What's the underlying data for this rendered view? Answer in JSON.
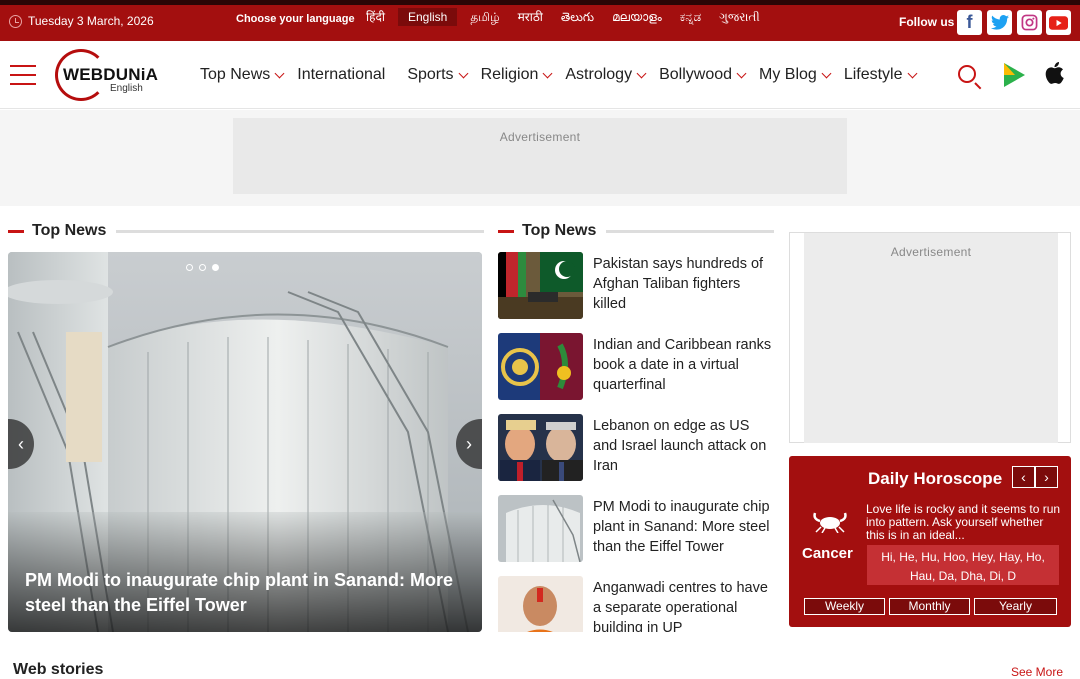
{
  "topbar": {
    "date": "Tuesday 3 March, 2026",
    "language_label": "Choose your language",
    "languages": [
      "हिंदी",
      "English",
      "தமிழ்",
      "मराठी",
      "తెలుగు",
      "മലയാളം",
      "ಕನ್ನಡ",
      "ગુજરાતી"
    ],
    "active_language": "English",
    "follow_label": "Follow us",
    "social_icons": [
      "facebook-icon",
      "twitter-icon",
      "instagram-icon",
      "youtube-icon"
    ],
    "colors": {
      "background": "#a30f0f",
      "active": "#7b0b0b"
    }
  },
  "header": {
    "logo_text": "WEBDUNiA",
    "logo_sub": "English",
    "menu": [
      {
        "label": "Top News",
        "dropdown": true
      },
      {
        "label": "International",
        "dropdown": false
      },
      {
        "label": "Sports",
        "dropdown": true
      },
      {
        "label": "Religion",
        "dropdown": true
      },
      {
        "label": "Astrology",
        "dropdown": true
      },
      {
        "label": "Bollywood",
        "dropdown": true
      },
      {
        "label": "My Blog",
        "dropdown": true
      },
      {
        "label": "Lifestyle",
        "dropdown": true
      }
    ],
    "icons": [
      "search-icon",
      "google-play-icon",
      "apple-icon"
    ]
  },
  "ads": {
    "top": "Advertisement",
    "right": "Advertisement"
  },
  "featured": {
    "heading": "Top News",
    "slide_title": "PM Modi to inaugurate chip plant in Sanand: More steel than the Eiffel Tower",
    "slide_count": 3,
    "active_slide": 3
  },
  "news_list": {
    "heading": "Top News",
    "items": [
      {
        "title": "Pakistan says hundreds of Afghan Taliban fighters killed"
      },
      {
        "title": "Indian and Caribbean ranks book a date in a virtual quarterfinal"
      },
      {
        "title": "Lebanon on edge as US and Israel launch attack on Iran"
      },
      {
        "title": "PM Modi to inaugurate chip plant in Sanand: More steel than the Eiffel Tower"
      },
      {
        "title": "Anganwadi centres to have a separate operational building in UP"
      }
    ]
  },
  "horoscope": {
    "title": "Daily Horoscope",
    "prev": "‹",
    "next": "›",
    "sign": "Cancer",
    "symbol": "♋",
    "text": "Love life is rocky and it seems to run into pattern. Ask yourself whether this is in an ideal...",
    "sounds": "Hi, He, Hu, Hoo, Hey, Hay, Ho, Hau, Da, Dha, Di, D",
    "tabs": [
      "Weekly",
      "Monthly",
      "Yearly"
    ]
  },
  "web_stories": {
    "heading": "Web stories",
    "see_more": "See More"
  }
}
